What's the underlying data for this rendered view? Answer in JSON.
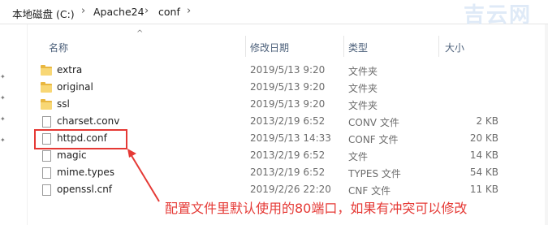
{
  "breadcrumb": {
    "items": [
      "本地磁盘 (C:)",
      "Apache24",
      "conf"
    ]
  },
  "watermark": "吉云网",
  "columns": {
    "name": "名称",
    "date": "修改日期",
    "type": "类型",
    "size": "大小"
  },
  "files": [
    {
      "name": "extra",
      "date": "2019/5/13 9:20",
      "type": "文件夹",
      "size": "",
      "kind": "folder"
    },
    {
      "name": "original",
      "date": "2019/5/13 9:20",
      "type": "文件夹",
      "size": "",
      "kind": "folder"
    },
    {
      "name": "ssl",
      "date": "2019/5/13 9:20",
      "type": "文件夹",
      "size": "",
      "kind": "folder"
    },
    {
      "name": "charset.conv",
      "date": "2013/2/19 6:52",
      "type": "CONV 文件",
      "size": "2 KB",
      "kind": "file"
    },
    {
      "name": "httpd.conf",
      "date": "2019/5/13 14:33",
      "type": "CONF 文件",
      "size": "20 KB",
      "kind": "file"
    },
    {
      "name": "magic",
      "date": "2013/2/19 6:52",
      "type": "文件",
      "size": "14 KB",
      "kind": "file"
    },
    {
      "name": "mime.types",
      "date": "2013/2/19 6:52",
      "type": "TYPES 文件",
      "size": "54 KB",
      "kind": "file"
    },
    {
      "name": "openssl.cnf",
      "date": "2019/2/26 22:20",
      "type": "CNF 文件",
      "size": "11 KB",
      "kind": "file"
    }
  ],
  "annotation": "配置文件里默认使用的80端口，如果有冲突可以修改",
  "colors": {
    "annotation": "#e53935",
    "folder": "#f8d775",
    "header_text": "#4c607a"
  }
}
